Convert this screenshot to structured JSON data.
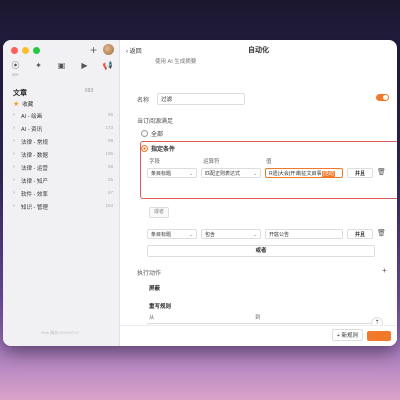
{
  "sidebar": {
    "plus_icon": "+",
    "icons": [
      {
        "name": "rss-icon",
        "glyph": "⦿",
        "badge": "99+"
      },
      {
        "name": "twitter-icon",
        "glyph": "✦",
        "badge": ""
      },
      {
        "name": "image-icon",
        "glyph": "▣",
        "badge": ""
      },
      {
        "name": "video-icon",
        "glyph": "▶",
        "badge": ""
      },
      {
        "name": "megaphone-icon",
        "glyph": "📢",
        "badge": ""
      }
    ],
    "articles_title": "文章",
    "articles_count": "683",
    "favorites_label": "收藏",
    "categories": [
      {
        "label": "AI - 绘画",
        "count": "55"
      },
      {
        "label": "AI - 资讯",
        "count": "173"
      },
      {
        "label": "法律 - 常规",
        "count": "99"
      },
      {
        "label": "法律 - 数据",
        "count": "106"
      },
      {
        "label": "法律 - 运营",
        "count": "58"
      },
      {
        "label": "法律 - 知产",
        "count": "26"
      },
      {
        "label": "软件 - 效率",
        "count": "57"
      },
      {
        "label": "知识 - 管理",
        "count": "104"
      }
    ],
    "footer": "Web 服务 2021/07/17"
  },
  "header": {
    "back_label": "返回",
    "title": "自动化"
  },
  "form": {
    "top_cut_text": "使用 AI 生成摘要",
    "name_label": "名称",
    "name_value": "过滤",
    "condition_label": "当订阅源满足",
    "option_all": "全部",
    "option_specified": "指定条件",
    "col_field": "字段",
    "col_operator": "运算符",
    "col_value": "值",
    "row1": {
      "field": "条目标题",
      "operator": "匹配正则表达式",
      "value": "R遗|大会|开课|征文启事",
      "value_highlight": "|活动",
      "and": "并且"
    },
    "or_small": "或者",
    "row2": {
      "field": "条目标题",
      "operator": "包含",
      "value": "开庭公告",
      "and": "并且"
    },
    "or_button": "或者",
    "actions_label": "执行动作",
    "block_label": "屏蔽",
    "rewrite_label": "重写规则",
    "from_label": "从",
    "to_label": "到",
    "add_button": "添加"
  },
  "footer": {
    "new_rule": "+ 新规则"
  }
}
